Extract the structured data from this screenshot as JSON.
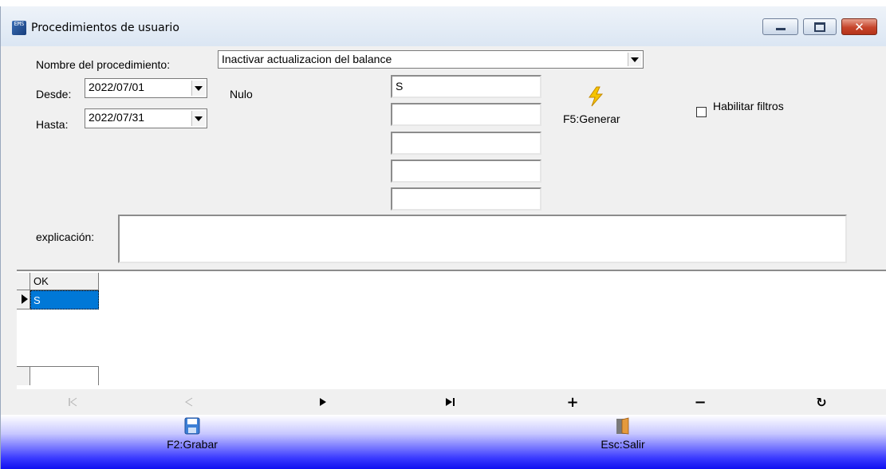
{
  "window": {
    "title": "Procedimientos de usuario",
    "app_icon_text": "EMS",
    "close_glyph": "✕"
  },
  "form": {
    "procedure_label": "Nombre del procedimiento:",
    "procedure_value": "Inactivar actualizacion del balance",
    "desde_label": "Desde:",
    "desde_value": "2022/07/01",
    "hasta_label": "Hasta:",
    "hasta_value": "2022/07/31",
    "nulo_label": "Nulo",
    "params": [
      "S",
      "",
      "",
      "",
      ""
    ],
    "generate_label": "F5:Generar",
    "filters_label": "Habilitar filtros",
    "filters_checked": false,
    "explanation_label": "explicación:",
    "explanation_value": ""
  },
  "grid": {
    "column_header": "OK",
    "rows": [
      {
        "value": "S",
        "selected": true
      }
    ]
  },
  "navigator": {
    "buttons": [
      "first",
      "prior",
      "next",
      "last",
      "insert",
      "delete",
      "refresh"
    ],
    "glyphs": {
      "next": "▶",
      "insert": "+",
      "delete": "−",
      "refresh": "↻"
    }
  },
  "bottom": {
    "save_label": "F2:Grabar",
    "exit_label": "Esc:Salir"
  },
  "colors": {
    "selection": "#0078d7",
    "bottom_bar": "#1010f0",
    "generate_icon": "#f5c400"
  }
}
